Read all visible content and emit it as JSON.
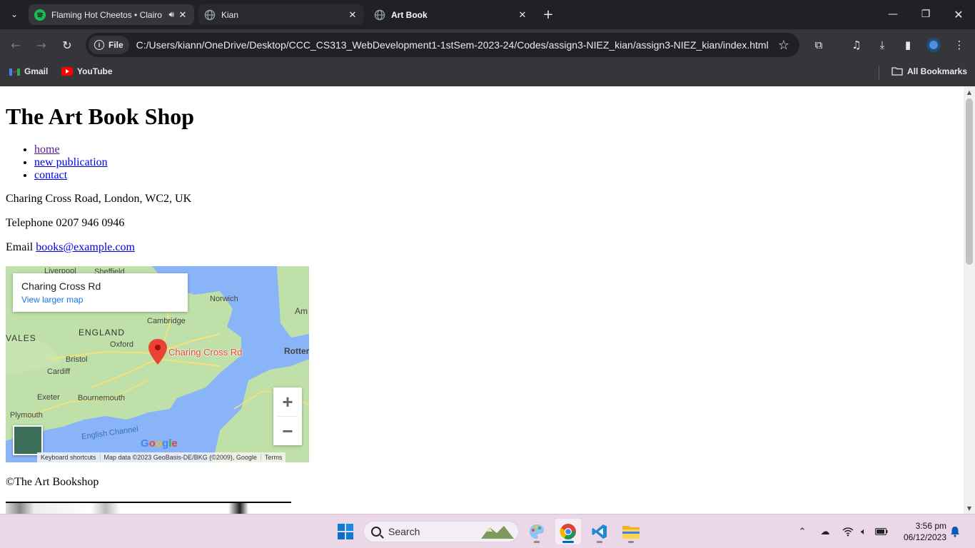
{
  "browser": {
    "tabs": [
      {
        "title": "Flaming Hot Cheetos • Clairo",
        "favicon": "spotify-icon",
        "audio": true,
        "active": false
      },
      {
        "title": "Kian",
        "favicon": "globe-icon",
        "audio": false,
        "active": false
      },
      {
        "title": "Art Book",
        "favicon": "globe-icon",
        "audio": false,
        "active": true
      }
    ],
    "site_chip": "File",
    "url": "C:/Users/kiann/OneDrive/Desktop/CCC_CS313_WebDevelopment1-1stSem-2023-24/Codes/assign3-NIEZ_kian/assign3-NIEZ_kian/index.html",
    "bookmarks": [
      {
        "label": "Gmail",
        "icon": "gmail-icon"
      },
      {
        "label": "YouTube",
        "icon": "youtube-icon"
      }
    ],
    "all_bookmarks": "All Bookmarks"
  },
  "page": {
    "heading": "The Art Book Shop",
    "nav": [
      "home",
      "new publication",
      "contact"
    ],
    "address": "Charing Cross Road, London, WC2, UK",
    "telephone_label": "Telephone",
    "telephone": "0207 946 0946",
    "email_label": "Email",
    "email": "books@example.com",
    "footer": "©The Art Bookshop"
  },
  "map": {
    "place_name": "Charing Cross Rd",
    "view_larger": "View larger map",
    "marker_label": "Charing Cross Rd",
    "labels": [
      "Liverpool",
      "Sheffield",
      "Norwich",
      "Am",
      "Cambridge",
      "ENGLAND",
      "VALES",
      "Oxford",
      "Rotter",
      "Bristol",
      "Cardiff",
      "Exeter",
      "Bournemouth",
      "Plymouth",
      "English Channel"
    ],
    "zoom_in": "+",
    "zoom_out": "−",
    "logo": "Google",
    "footer": [
      "Keyboard shortcuts",
      "Map data ©2023 GeoBasis-DE/BKG (©2009), Google",
      "Terms"
    ],
    "colors": {
      "water": "#8ab4f8",
      "land": "#bfe0a8",
      "marker": "#ea4335"
    }
  },
  "taskbar": {
    "search_placeholder": "Search",
    "time": "3:56 pm",
    "date": "06/12/2023",
    "apps": [
      "windows-start-icon",
      "paint-icon",
      "chrome-icon",
      "vscode-icon",
      "file-explorer-icon"
    ]
  }
}
